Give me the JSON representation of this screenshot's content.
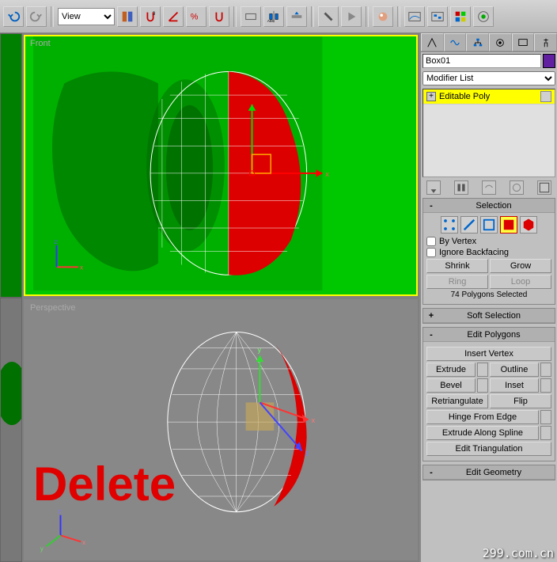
{
  "toolbar": {
    "view_label": "View"
  },
  "viewports": {
    "front_label": "Front",
    "perspective_label": "Perspective"
  },
  "overlay": {
    "delete_text": "Delete",
    "watermark": "299.com.cn"
  },
  "panel": {
    "object_name": "Box01",
    "modifier_list_label": "Modifier List",
    "modifier_item": "Editable Poly"
  },
  "selection": {
    "title": "Selection",
    "by_vertex": "By Vertex",
    "ignore_backfacing": "Ignore Backfacing",
    "shrink": "Shrink",
    "grow": "Grow",
    "ring": "Ring",
    "loop": "Loop",
    "status": "74 Polygons Selected"
  },
  "soft_selection": {
    "title": "Soft Selection"
  },
  "edit_polygons": {
    "title": "Edit Polygons",
    "insert_vertex": "Insert Vertex",
    "extrude": "Extrude",
    "outline": "Outline",
    "bevel": "Bevel",
    "inset": "Inset",
    "retriangulate": "Retriangulate",
    "flip": "Flip",
    "hinge_from_edge": "Hinge From Edge",
    "extrude_along_spline": "Extrude Along Spline",
    "edit_triangulation": "Edit Triangulation"
  },
  "edit_geometry": {
    "title": "Edit Geometry"
  }
}
